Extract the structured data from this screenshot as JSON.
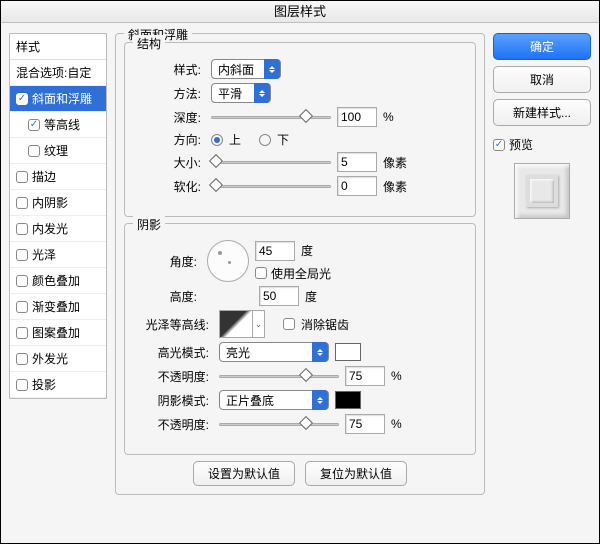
{
  "title": "图层样式",
  "left": {
    "header": "样式",
    "blending": "混合选项:自定",
    "items": [
      {
        "label": "斜面和浮雕",
        "checked": true,
        "selected": true,
        "sub": false
      },
      {
        "label": "等高线",
        "checked": true,
        "selected": false,
        "sub": true
      },
      {
        "label": "纹理",
        "checked": false,
        "selected": false,
        "sub": true
      },
      {
        "label": "描边",
        "checked": false,
        "selected": false,
        "sub": false
      },
      {
        "label": "内阴影",
        "checked": false,
        "selected": false,
        "sub": false
      },
      {
        "label": "内发光",
        "checked": false,
        "selected": false,
        "sub": false
      },
      {
        "label": "光泽",
        "checked": false,
        "selected": false,
        "sub": false
      },
      {
        "label": "颜色叠加",
        "checked": false,
        "selected": false,
        "sub": false
      },
      {
        "label": "渐变叠加",
        "checked": false,
        "selected": false,
        "sub": false
      },
      {
        "label": "图案叠加",
        "checked": false,
        "selected": false,
        "sub": false
      },
      {
        "label": "外发光",
        "checked": false,
        "selected": false,
        "sub": false
      },
      {
        "label": "投影",
        "checked": false,
        "selected": false,
        "sub": false
      }
    ]
  },
  "center": {
    "bevel_title": "斜面和浮雕",
    "structure_title": "结构",
    "style_label": "样式:",
    "style_value": "内斜面",
    "method_label": "方法:",
    "method_value": "平滑",
    "depth_label": "深度:",
    "depth_value": "100",
    "pct": "%",
    "direction_label": "方向:",
    "up": "上",
    "down": "下",
    "size_label": "大小:",
    "size_value": "5",
    "px": "像素",
    "soften_label": "软化:",
    "soften_value": "0",
    "shading_title": "阴影",
    "angle_label": "角度:",
    "angle_value": "45",
    "deg": "度",
    "global": "使用全局光",
    "altitude_label": "高度:",
    "altitude_value": "50",
    "gloss_label": "光泽等高线:",
    "antialias": "消除锯齿",
    "hilite_mode_label": "高光模式:",
    "hilite_mode_value": "亮光",
    "opacity_label": "不透明度:",
    "hilite_opacity": "75",
    "shadow_mode_label": "阴影模式:",
    "shadow_mode_value": "正片叠底",
    "shadow_opacity": "75",
    "default_set": "设置为默认值",
    "default_reset": "复位为默认值"
  },
  "right": {
    "ok": "确定",
    "cancel": "取消",
    "newstyle": "新建样式...",
    "preview": "预览"
  }
}
